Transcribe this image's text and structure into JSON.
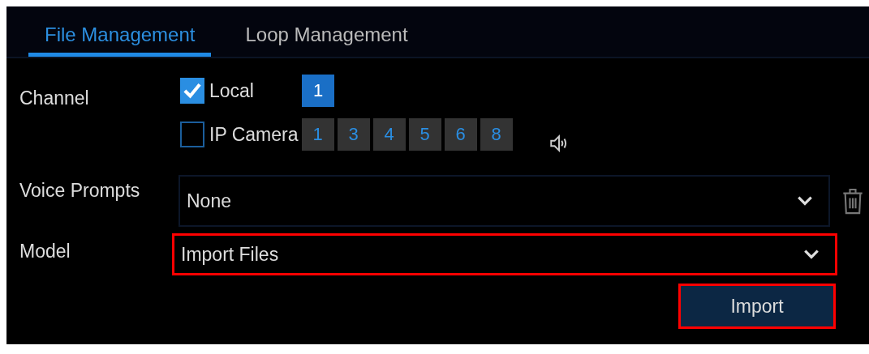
{
  "tabs": [
    {
      "label": "File Management",
      "selected": true
    },
    {
      "label": "Loop Management",
      "selected": false
    }
  ],
  "channel": {
    "label": "Channel",
    "groups": [
      {
        "label": "Local",
        "checked": true,
        "channels": [
          {
            "label": "1",
            "selected": true
          }
        ]
      },
      {
        "label": "IP Camera",
        "checked": false,
        "channels": [
          {
            "label": "1",
            "selected": false
          },
          {
            "label": "3",
            "selected": false
          },
          {
            "label": "4",
            "selected": false
          },
          {
            "label": "5",
            "selected": false
          },
          {
            "label": "6",
            "selected": false
          },
          {
            "label": "8",
            "selected": false
          }
        ]
      }
    ]
  },
  "voice_prompts": {
    "label": "Voice Prompts",
    "value": "None",
    "highlighted": false
  },
  "model": {
    "label": "Model",
    "value": "Import Files",
    "highlighted": true
  },
  "import_button": {
    "label": "Import",
    "highlighted": true
  }
}
